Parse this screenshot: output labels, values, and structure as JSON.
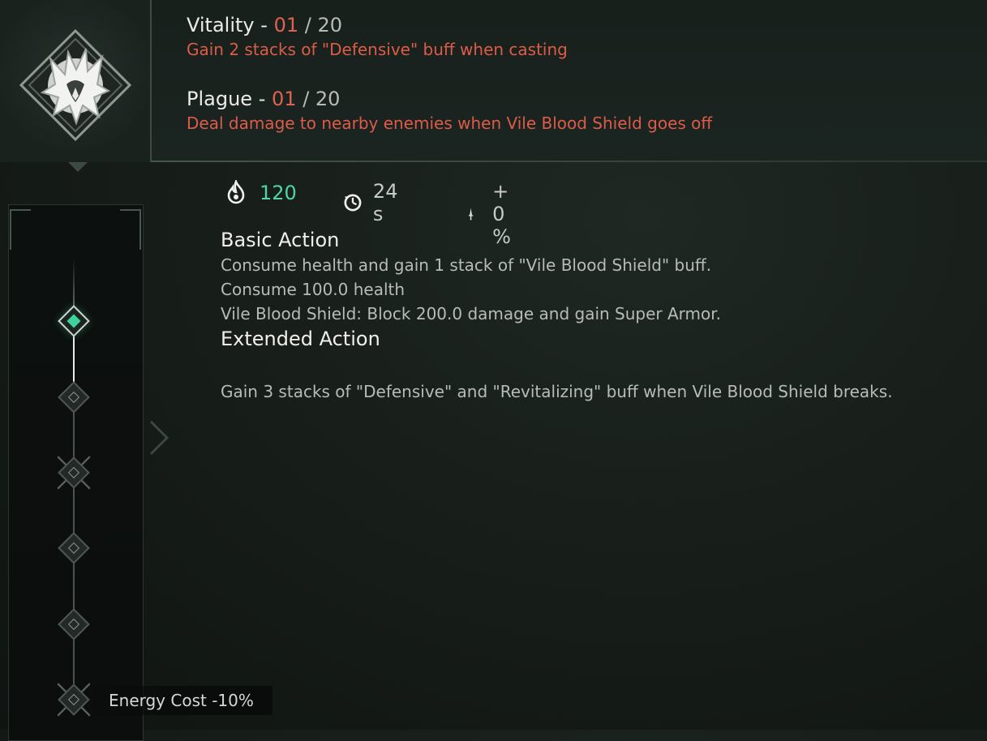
{
  "traits": [
    {
      "name": "Vitality",
      "separator": "-",
      "level": "01",
      "max": "20",
      "description": "Gain 2 stacks of \"Defensive\" buff when casting"
    },
    {
      "name": "Plague",
      "separator": "-",
      "level": "01",
      "max": "20",
      "description": "Deal damage to nearby enemies when Vile Blood Shield goes off"
    }
  ],
  "stats": {
    "cost": "120",
    "cost_icon": "flame-icon",
    "cooldown": "24 s",
    "cooldown_icon": "cooldown-icon",
    "damage": "+ 0 %",
    "damage_icon": "dagger-icon"
  },
  "basic_action": {
    "title": "Basic Action",
    "lines": [
      "Consume health and gain 1 stack of \"Vile Blood Shield\" buff.",
      "Consume 100.0 health",
      "Vile Blood Shield: Block 200.0 damage and gain Super Armor."
    ]
  },
  "extended_action": {
    "title": "Extended Action",
    "lines": [
      "Gain 3 stacks of \"Defensive\" and \"Revitalizing\" buff when Vile Blood Shield breaks."
    ]
  },
  "progression": {
    "nodes": [
      "active",
      "inactive",
      "inactive",
      "inactive",
      "inactive",
      "inactive"
    ],
    "energy_label": "Energy Cost -10%"
  },
  "colors": {
    "accent_red": "#e0614e",
    "accent_teal": "#4fd6a5",
    "active_node": "#3fd39c"
  }
}
